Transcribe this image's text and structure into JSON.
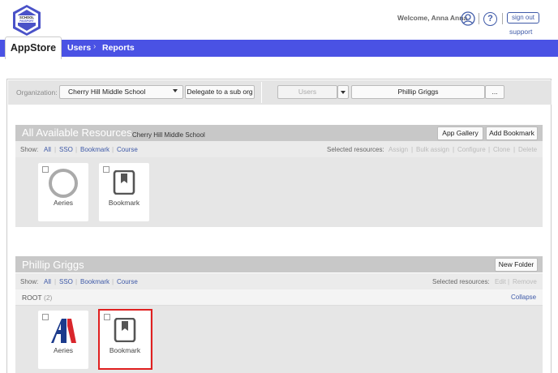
{
  "header": {
    "logo_line1": "SCHOOL",
    "logo_line2": "PASSPORT",
    "welcome": "Welcome, Anna Anna",
    "help_glyph": "?",
    "signout": "sign out",
    "support": "support",
    "icons": {
      "user": "user-circle-icon",
      "help": "help-circle-icon"
    }
  },
  "nav": {
    "app_tab": "AppStore",
    "users": "Users",
    "separator": "›",
    "reports": "Reports",
    "accent": "#4a52e4"
  },
  "toolbar": {
    "org_label": "Organization:",
    "org_value": "Cherry Hill Middle School",
    "delegate": "Delegate to a sub org",
    "users_select": "Users",
    "person": "Phillip Griggs",
    "ellipsis": "..."
  },
  "available": {
    "title": "All Available Resources",
    "org": "Cherry Hill Middle School",
    "app_gallery": "App Gallery",
    "add_bookmark": "Add Bookmark",
    "show_label": "Show:",
    "filters": [
      "All",
      "SSO",
      "Bookmark",
      "Course"
    ],
    "selected_label": "Selected resources:",
    "actions": [
      "Assign",
      "Bulk assign",
      "Configure",
      "Clone",
      "Delete"
    ],
    "tiles": [
      {
        "label": "Aeries",
        "icon": "aeries-circle-icon"
      },
      {
        "label": "Bookmark",
        "icon": "bookmark-icon"
      }
    ]
  },
  "user_section": {
    "title": "Phillip Griggs",
    "new_folder": "New Folder",
    "show_label": "Show:",
    "filters": [
      "All",
      "SSO",
      "Bookmark",
      "Course"
    ],
    "selected_label": "Selected resources:",
    "actions": [
      "Edit",
      "Remove"
    ],
    "root_label": "ROOT",
    "root_count": "(2)",
    "collapse": "Collapse",
    "tiles": [
      {
        "label": "Aeries",
        "icon": "aeries-a-logo-icon"
      },
      {
        "label": "Bookmark",
        "icon": "bookmark-icon"
      }
    ],
    "highlight_color": "#e02020"
  }
}
